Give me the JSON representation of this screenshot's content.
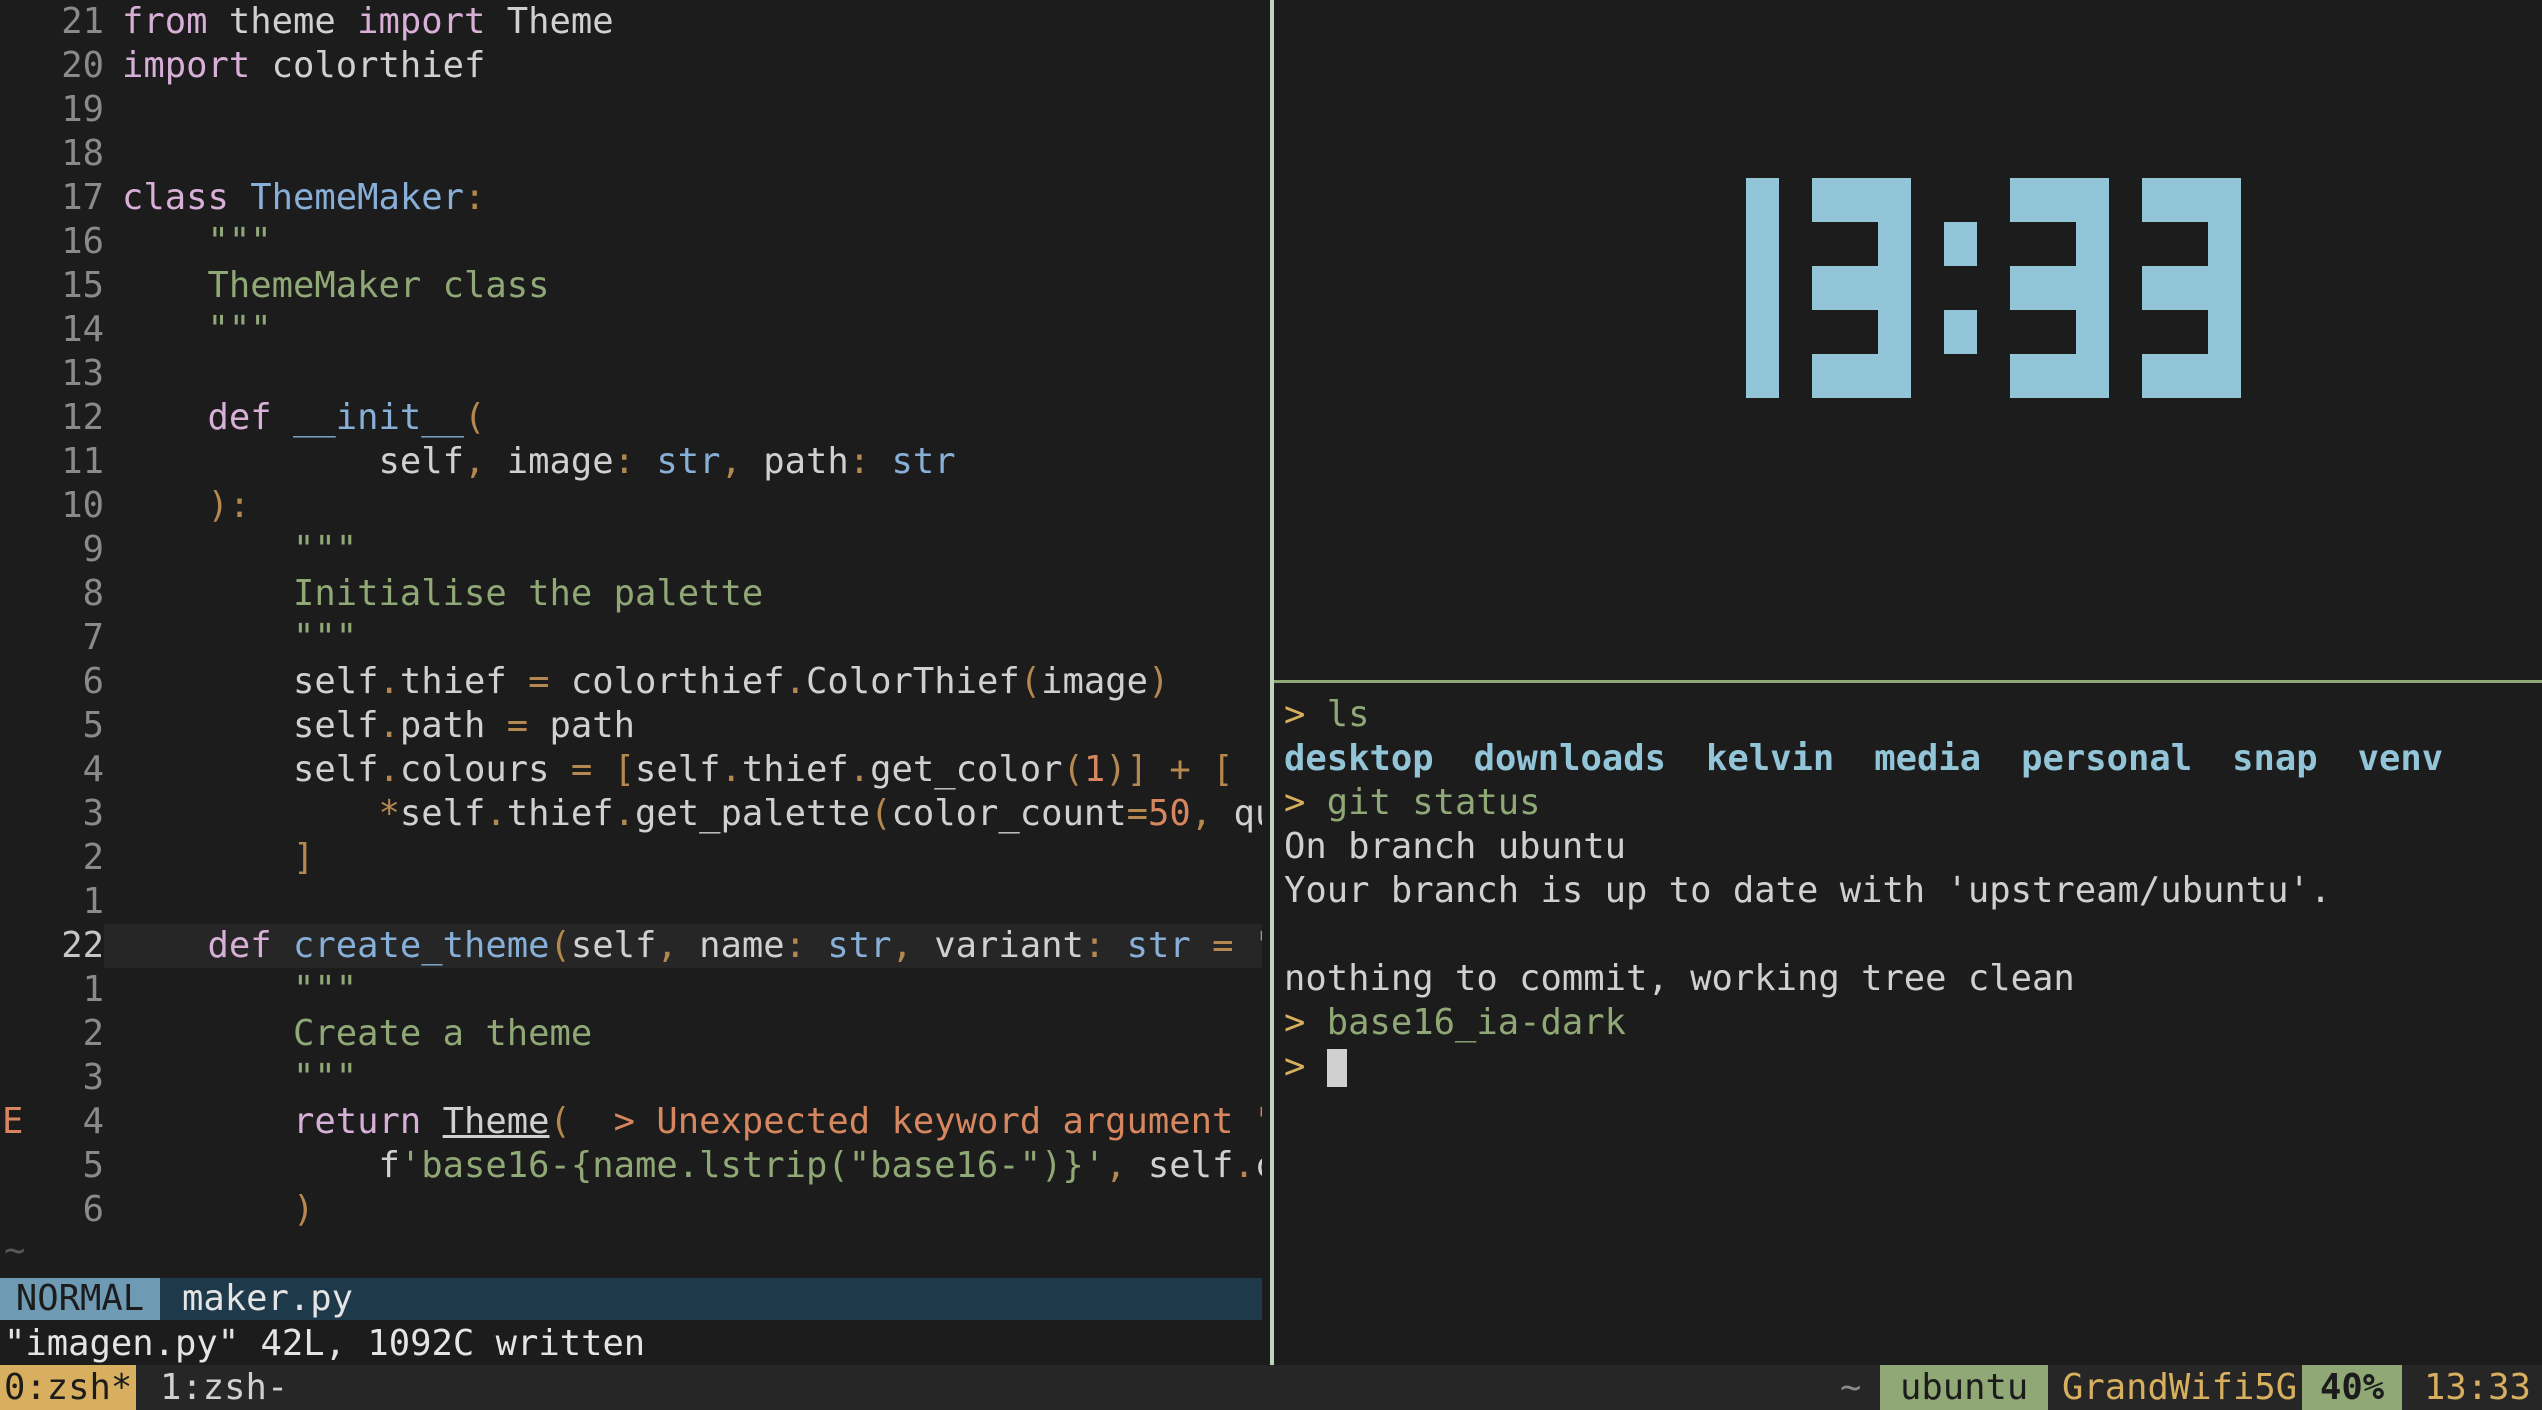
{
  "editor": {
    "lines": [
      {
        "sign": "",
        "num": "21",
        "current": false,
        "tokens": [
          [
            "k",
            "from"
          ],
          [
            "t",
            " theme "
          ],
          [
            "k",
            "import"
          ],
          [
            "t",
            " Theme"
          ]
        ]
      },
      {
        "sign": "",
        "num": "20",
        "current": false,
        "tokens": [
          [
            "k",
            "import"
          ],
          [
            "t",
            " colorthief"
          ]
        ]
      },
      {
        "sign": "",
        "num": "19",
        "current": false,
        "tokens": []
      },
      {
        "sign": "",
        "num": "18",
        "current": false,
        "tokens": []
      },
      {
        "sign": "",
        "num": "17",
        "current": false,
        "tokens": [
          [
            "k",
            "class"
          ],
          [
            "t",
            " "
          ],
          [
            "f",
            "ThemeMaker"
          ],
          [
            "p",
            ":"
          ]
        ]
      },
      {
        "sign": "",
        "num": "16",
        "current": false,
        "tokens": [
          [
            "t",
            "    "
          ],
          [
            "s",
            "\"\"\""
          ]
        ]
      },
      {
        "sign": "",
        "num": "15",
        "current": false,
        "tokens": [
          [
            "t",
            "    "
          ],
          [
            "s",
            "ThemeMaker class"
          ]
        ]
      },
      {
        "sign": "",
        "num": "14",
        "current": false,
        "tokens": [
          [
            "t",
            "    "
          ],
          [
            "s",
            "\"\"\""
          ]
        ]
      },
      {
        "sign": "",
        "num": "13",
        "current": false,
        "tokens": []
      },
      {
        "sign": "",
        "num": "12",
        "current": false,
        "tokens": [
          [
            "t",
            "    "
          ],
          [
            "k",
            "def"
          ],
          [
            "t",
            " "
          ],
          [
            "f",
            "__init__"
          ],
          [
            "p",
            "("
          ]
        ]
      },
      {
        "sign": "",
        "num": "11",
        "current": false,
        "tokens": [
          [
            "t",
            "            self"
          ],
          [
            "p",
            ","
          ],
          [
            "t",
            " image"
          ],
          [
            "p",
            ":"
          ],
          [
            "t",
            " "
          ],
          [
            "f",
            "str"
          ],
          [
            "p",
            ","
          ],
          [
            "t",
            " path"
          ],
          [
            "p",
            ":"
          ],
          [
            "t",
            " "
          ],
          [
            "f",
            "str"
          ]
        ]
      },
      {
        "sign": "",
        "num": "10",
        "current": false,
        "tokens": [
          [
            "t",
            "    "
          ],
          [
            "p",
            "):"
          ]
        ]
      },
      {
        "sign": "",
        "num": "9",
        "current": false,
        "tokens": [
          [
            "t",
            "        "
          ],
          [
            "s",
            "\"\"\""
          ]
        ]
      },
      {
        "sign": "",
        "num": "8",
        "current": false,
        "tokens": [
          [
            "t",
            "        "
          ],
          [
            "s",
            "Initialise the palette"
          ]
        ]
      },
      {
        "sign": "",
        "num": "7",
        "current": false,
        "tokens": [
          [
            "t",
            "        "
          ],
          [
            "s",
            "\"\"\""
          ]
        ]
      },
      {
        "sign": "",
        "num": "6",
        "current": false,
        "tokens": [
          [
            "t",
            "        self"
          ],
          [
            "p",
            "."
          ],
          [
            "t",
            "thief "
          ],
          [
            "p",
            "="
          ],
          [
            "t",
            " colorthief"
          ],
          [
            "p",
            "."
          ],
          [
            "t",
            "ColorThief"
          ],
          [
            "p",
            "("
          ],
          [
            "t",
            "image"
          ],
          [
            "p",
            ")"
          ]
        ]
      },
      {
        "sign": "",
        "num": "5",
        "current": false,
        "tokens": [
          [
            "t",
            "        self"
          ],
          [
            "p",
            "."
          ],
          [
            "t",
            "path "
          ],
          [
            "p",
            "="
          ],
          [
            "t",
            " path"
          ]
        ]
      },
      {
        "sign": "",
        "num": "4",
        "current": false,
        "tokens": [
          [
            "t",
            "        self"
          ],
          [
            "p",
            "."
          ],
          [
            "t",
            "colours "
          ],
          [
            "p",
            "="
          ],
          [
            "t",
            " "
          ],
          [
            "p",
            "["
          ],
          [
            "t",
            "self"
          ],
          [
            "p",
            "."
          ],
          [
            "t",
            "thief"
          ],
          [
            "p",
            "."
          ],
          [
            "t",
            "get_color"
          ],
          [
            "p",
            "("
          ],
          [
            "n",
            "1"
          ],
          [
            "p",
            ")]"
          ],
          [
            "t",
            " "
          ],
          [
            "p",
            "+"
          ],
          [
            "t",
            " "
          ],
          [
            "p",
            "["
          ]
        ]
      },
      {
        "sign": "",
        "num": "3",
        "current": false,
        "tokens": [
          [
            "t",
            "            "
          ],
          [
            "p",
            "*"
          ],
          [
            "t",
            "self"
          ],
          [
            "p",
            "."
          ],
          [
            "t",
            "thief"
          ],
          [
            "p",
            "."
          ],
          [
            "t",
            "get_palette"
          ],
          [
            "p",
            "("
          ],
          [
            "t",
            "color_count"
          ],
          [
            "p",
            "="
          ],
          [
            "n",
            "50"
          ],
          [
            "p",
            ","
          ],
          [
            "t",
            " quali"
          ]
        ]
      },
      {
        "sign": "",
        "num": "2",
        "current": false,
        "tokens": [
          [
            "t",
            "        "
          ],
          [
            "p",
            "]"
          ]
        ]
      },
      {
        "sign": "",
        "num": "1",
        "current": false,
        "tokens": []
      },
      {
        "sign": "",
        "num": "22",
        "current": true,
        "tokens": [
          [
            "t",
            "    "
          ],
          [
            "k",
            "def"
          ],
          [
            "t",
            " "
          ],
          [
            "f",
            "create_theme"
          ],
          [
            "p",
            "("
          ],
          [
            "t",
            "self"
          ],
          [
            "p",
            ","
          ],
          [
            "t",
            " name"
          ],
          [
            "p",
            ":"
          ],
          [
            "t",
            " "
          ],
          [
            "f",
            "str"
          ],
          [
            "p",
            ","
          ],
          [
            "t",
            " variant"
          ],
          [
            "p",
            ":"
          ],
          [
            "t",
            " "
          ],
          [
            "f",
            "str"
          ],
          [
            "t",
            " "
          ],
          [
            "p",
            "="
          ],
          [
            "t",
            " "
          ],
          [
            "s",
            "\"\""
          ],
          [
            "p",
            ","
          ]
        ]
      },
      {
        "sign": "",
        "num": "1",
        "current": false,
        "tokens": [
          [
            "t",
            "        "
          ],
          [
            "s",
            "\"\"\""
          ]
        ]
      },
      {
        "sign": "",
        "num": "2",
        "current": false,
        "tokens": [
          [
            "t",
            "        "
          ],
          [
            "s",
            "Create a theme"
          ]
        ]
      },
      {
        "sign": "",
        "num": "3",
        "current": false,
        "tokens": [
          [
            "t",
            "        "
          ],
          [
            "s",
            "\"\"\""
          ]
        ]
      },
      {
        "sign": "E",
        "num": "4",
        "current": false,
        "tokens": [
          [
            "t",
            "        "
          ],
          [
            "k",
            "return"
          ],
          [
            "t",
            " "
          ],
          [
            "u",
            "Theme"
          ],
          [
            "p",
            "("
          ],
          [
            "t",
            "  "
          ],
          [
            "err",
            "> Unexpected keyword argument \"pat"
          ]
        ]
      },
      {
        "sign": "",
        "num": "5",
        "current": false,
        "tokens": [
          [
            "t",
            "            f"
          ],
          [
            "s",
            "'base16-{name.lstrip(\"base16-\")}'"
          ],
          [
            "p",
            ","
          ],
          [
            "t",
            " self"
          ],
          [
            "p",
            "."
          ],
          [
            "t",
            "colo"
          ]
        ]
      },
      {
        "sign": "",
        "num": "6",
        "current": false,
        "tokens": [
          [
            "t",
            "        "
          ],
          [
            "p",
            ")"
          ]
        ]
      }
    ],
    "tilde": "~",
    "mode": "NORMAL",
    "filename": "maker.py",
    "message": "\"imagen.py\" 42L, 1092C written"
  },
  "clock": {
    "time": "13:33",
    "color": "#93c5d8"
  },
  "terminal": {
    "lines": [
      {
        "prompt": ">",
        "text": " ls",
        "style": "cmd"
      },
      {
        "dirs": [
          "desktop",
          "downloads",
          "kelvin",
          "media",
          "personal",
          "snap",
          "venv"
        ]
      },
      {
        "prompt": ">",
        "text": " git status",
        "style": "cmd"
      },
      {
        "text": "On branch ubuntu",
        "style": "out"
      },
      {
        "text": "Your branch is up to date with 'upstream/ubuntu'.",
        "style": "out"
      },
      {
        "text": "",
        "style": "out"
      },
      {
        "text": "nothing to commit, working tree clean",
        "style": "out"
      },
      {
        "prompt": ">",
        "text": " base16_ia-dark",
        "style": "cmd"
      },
      {
        "prompt": ">",
        "text": " ",
        "style": "cursor"
      }
    ]
  },
  "tmux": {
    "window0": "0:zsh*",
    "window1": "1:zsh-",
    "tilde": "~",
    "host": "ubuntu",
    "wifi": "GrandWifi5G",
    "battery": "40%",
    "time": "13:33"
  }
}
